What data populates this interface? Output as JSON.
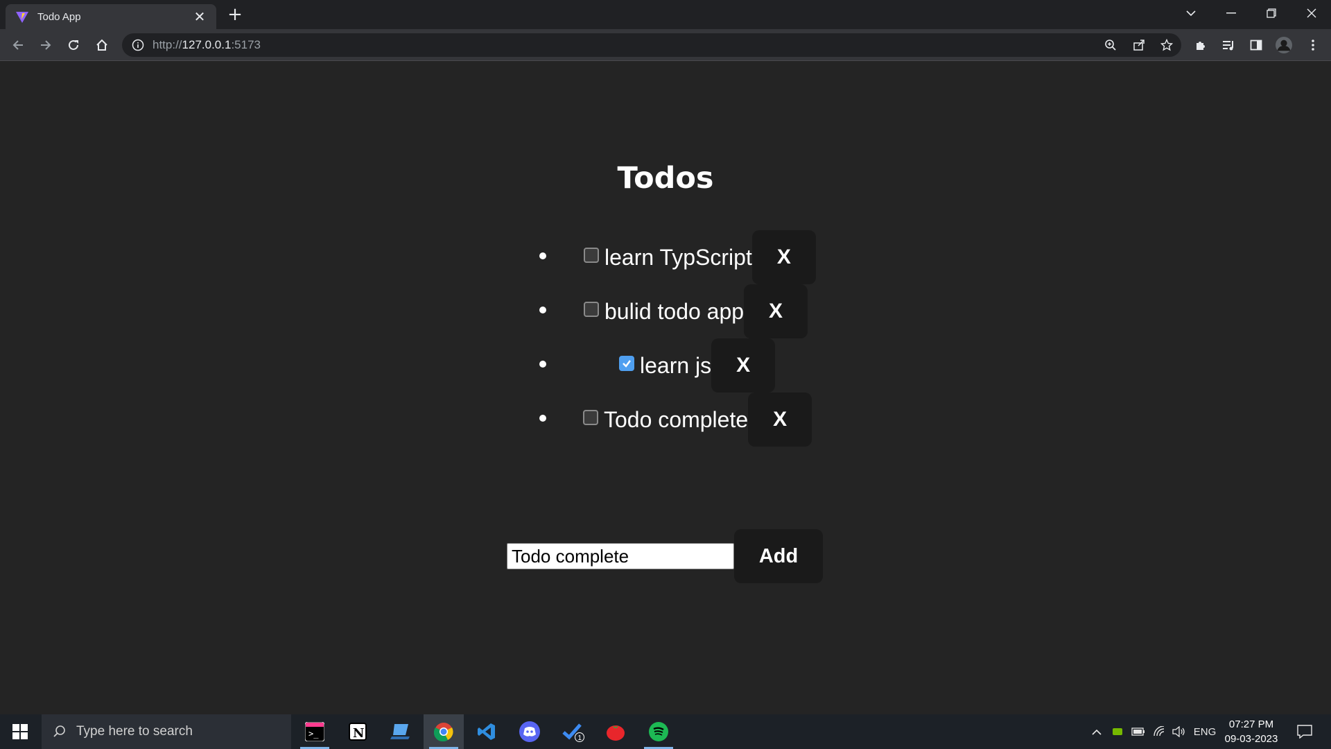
{
  "browser": {
    "tab_title": "Todo App",
    "url_scheme": "http://",
    "url_host": "127.0.0.1",
    "url_port": ":5173"
  },
  "page": {
    "heading": "Todos",
    "todos": [
      {
        "text": "learn TypScript",
        "completed": false,
        "delete_label": "X"
      },
      {
        "text": "bulid todo app",
        "completed": false,
        "delete_label": "X"
      },
      {
        "text": "learn js",
        "completed": true,
        "delete_label": "X"
      },
      {
        "text": "Todo complete",
        "completed": false,
        "delete_label": "X"
      }
    ],
    "input_value": "Todo complete",
    "add_label": "Add"
  },
  "taskbar": {
    "search_placeholder": "Type here to search",
    "language": "ENG",
    "time": "07:27 PM",
    "date": "09-03-2023",
    "todo_badge": "1"
  },
  "colors": {
    "page_bg": "#242424",
    "button_bg": "#1a1a1a",
    "checkbox_checked": "#4f9ff0"
  }
}
